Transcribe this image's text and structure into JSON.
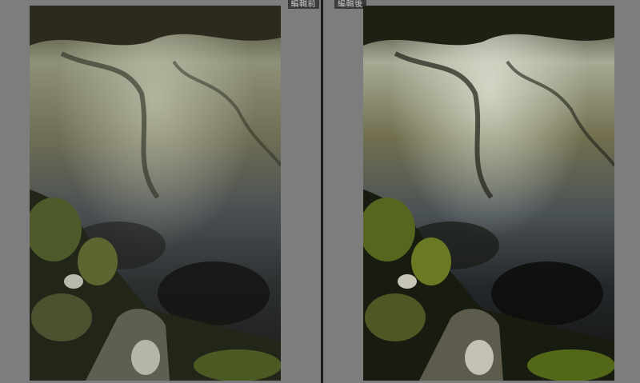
{
  "view": {
    "before_label": "編輯前",
    "after_label": "編輯後"
  },
  "colors": {
    "background": "#7d7d7d",
    "divider": "#1c1c1c",
    "label_bg": "#3b3b3b",
    "label_text": "#cfcfcf"
  }
}
